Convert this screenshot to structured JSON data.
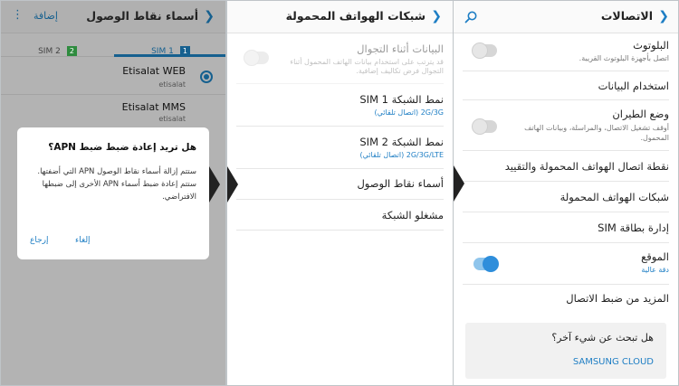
{
  "panel_connections": {
    "title": "الاتصالات",
    "items": [
      {
        "title": "البلوتوث",
        "subtitle": "اتصل بأجهزة البلوتوث القريبة."
      },
      {
        "title": "استخدام البيانات"
      },
      {
        "title": "وضع الطيران",
        "subtitle": "أوقف تشغيل الاتصال، والمراسلة، وبيانات الهاتف المحمول."
      },
      {
        "title": "نقطة اتصال الهواتف المحمولة والتقييد"
      },
      {
        "title": "شبكات الهواتف المحمولة"
      },
      {
        "title": "إدارة بطاقة SIM"
      },
      {
        "title": "الموقع",
        "subtitle": "دقة عالية"
      },
      {
        "title": "المزيد من ضبط الاتصال"
      }
    ],
    "suggestion": {
      "question": "هل تبحث عن شيء آخر؟",
      "link": "SAMSUNG CLOUD"
    }
  },
  "panel_mobile_networks": {
    "title": "شبكات الهواتف المحمولة",
    "items": [
      {
        "title": "البيانات أثناء التجوال",
        "subtitle": "قد يترتب على استخدام بيانات الهاتف المحمول أثناء التجوال فرض تكاليف إضافية."
      },
      {
        "title": "نمط الشبكة SIM 1",
        "subtitle": "2G/3G (اتصال تلقائي)"
      },
      {
        "title": "نمط الشبكة SIM 2",
        "subtitle": "2G/3G/LTE (اتصال تلقائي)"
      },
      {
        "title": "أسماء نقاط الوصول"
      },
      {
        "title": "مشغلو الشبكة"
      }
    ]
  },
  "panel_apn": {
    "title": "أسماء نقاط الوصول",
    "action": "إضافة",
    "menu": "⋮",
    "tabs": [
      {
        "label": "SIM 1",
        "badge": "1"
      },
      {
        "label": "SIM 2",
        "badge": "2"
      }
    ],
    "apns": [
      {
        "name": "Etisalat WEB",
        "carrier": "etisalat"
      },
      {
        "name": "Etisalat MMS",
        "carrier": "etisalat"
      }
    ],
    "dialog": {
      "title": "هل تريد إعادة ضبط ضبط APN؟",
      "body": "ستتم إزالة أسماء نقاط الوصول APN التي أضفتها. ستتم إعادة ضبط أسماء APN الأخرى إلى ضبطها الافتراضي.",
      "cancel": "إلغاء",
      "reset": "إرجاع"
    }
  },
  "colors": {
    "accent": "#1e7ec4",
    "sim2_green": "#2e8b3e"
  }
}
